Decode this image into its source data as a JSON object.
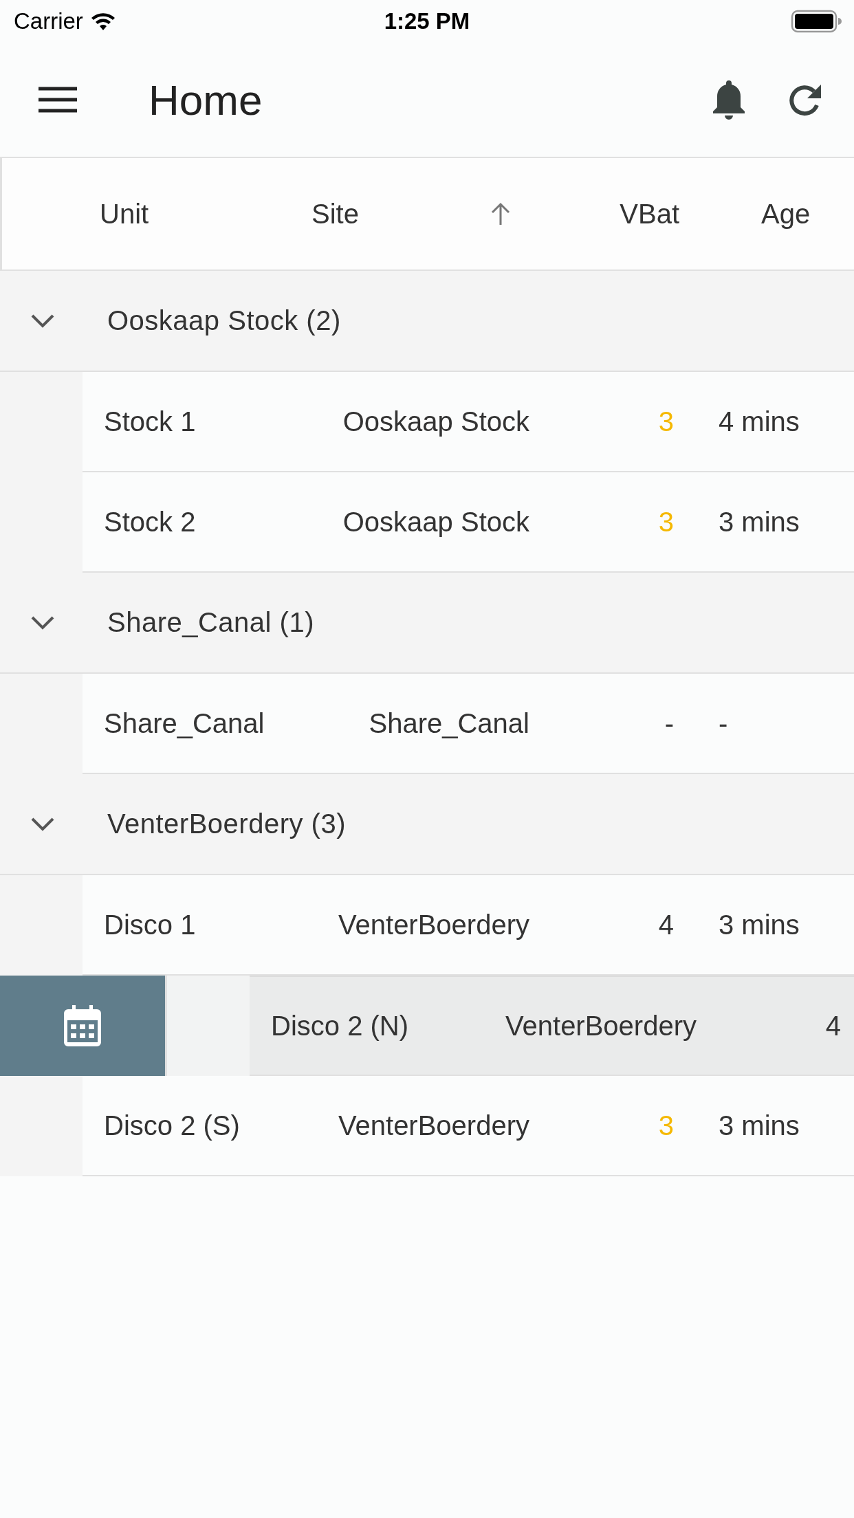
{
  "status_bar": {
    "carrier": "Carrier",
    "time": "1:25 PM"
  },
  "app_bar": {
    "title": "Home"
  },
  "table": {
    "columns": [
      {
        "label": "Unit",
        "sorted": false
      },
      {
        "label": "Site",
        "sorted": true
      },
      {
        "label": "VBat",
        "sorted": false
      },
      {
        "label": "Age",
        "sorted": false
      }
    ],
    "groups": [
      {
        "label": "Ooskaap Stock (2)",
        "expanded": true,
        "rows": [
          {
            "unit": "Stock 1",
            "site": "Ooskaap Stock",
            "vbat": "3",
            "vbat_low": true,
            "age": "4 mins",
            "swiped": false
          },
          {
            "unit": "Stock 2",
            "site": "Ooskaap Stock",
            "vbat": "3",
            "vbat_low": true,
            "age": "3 mins",
            "swiped": false
          }
        ]
      },
      {
        "label": "Share_Canal (1)",
        "expanded": true,
        "rows": [
          {
            "unit": "Share_Canal",
            "site": "Share_Canal",
            "vbat": "-",
            "vbat_low": false,
            "age": "-",
            "swiped": false
          }
        ]
      },
      {
        "label": "VenterBoerdery (3)",
        "expanded": true,
        "rows": [
          {
            "unit": "Disco 1",
            "site": "VenterBoerdery",
            "vbat": "4",
            "vbat_low": false,
            "age": "3 mins",
            "swiped": false
          },
          {
            "unit": "Disco 2 (N)",
            "site": "VenterBoerdery",
            "vbat": "4",
            "vbat_low": false,
            "swiped": true
          },
          {
            "unit": "Disco 2 (S)",
            "site": "VenterBoerdery",
            "vbat": "3",
            "vbat_low": true,
            "age": "3 mins",
            "swiped": false
          }
        ]
      }
    ]
  }
}
